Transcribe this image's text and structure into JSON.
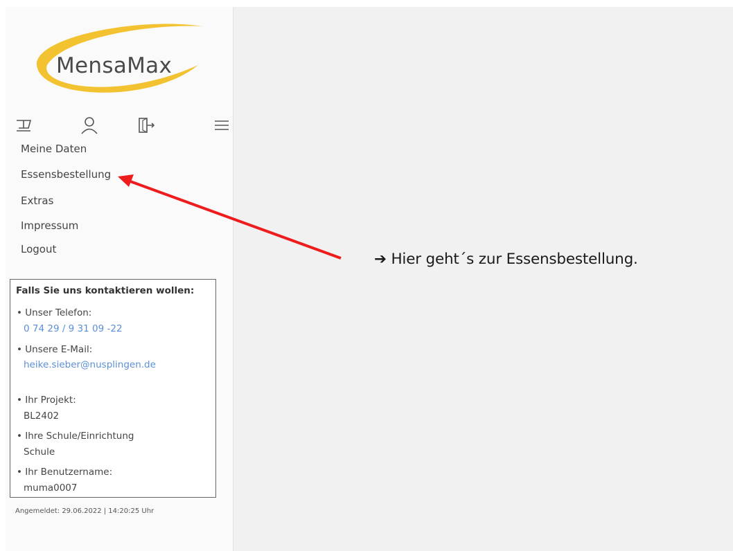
{
  "logo": {
    "text": "MensaMax"
  },
  "icons": [
    "cart-icon",
    "user-icon",
    "logout-door-icon",
    "menu-icon"
  ],
  "nav": {
    "items": [
      {
        "label": "Meine Daten"
      },
      {
        "label": "Essensbestellung"
      },
      {
        "label": "Extras"
      },
      {
        "label": "Impressum"
      },
      {
        "label": "Logout"
      }
    ]
  },
  "contact": {
    "title": "Falls Sie uns kontaktieren wollen:",
    "phone_label": "• Unser Telefon:",
    "phone": "0 74 29 / 9 31 09 -22",
    "email_label": "• Unsere E-Mail:",
    "email": "heike.sieber@nusplingen.de",
    "project_label": "• Ihr Projekt:",
    "project": "BL2402",
    "school_label": "• Ihre Schule/Einrichtung",
    "school": "Schule",
    "username_label": "• Ihr Benutzername:",
    "username": "muma0007"
  },
  "login_info": "Angemeldet: 29.06.2022 | 14:20:25 Uhr",
  "annotation": {
    "text": "➔ Hier geht´s zur Essensbestellung.",
    "arrow_color": "#ee1c1c"
  },
  "colors": {
    "logo_swoosh": "#f2c230",
    "link": "#5b8fd6",
    "sidebar_bg": "#fafafa",
    "main_bg": "#f1f1f1"
  }
}
